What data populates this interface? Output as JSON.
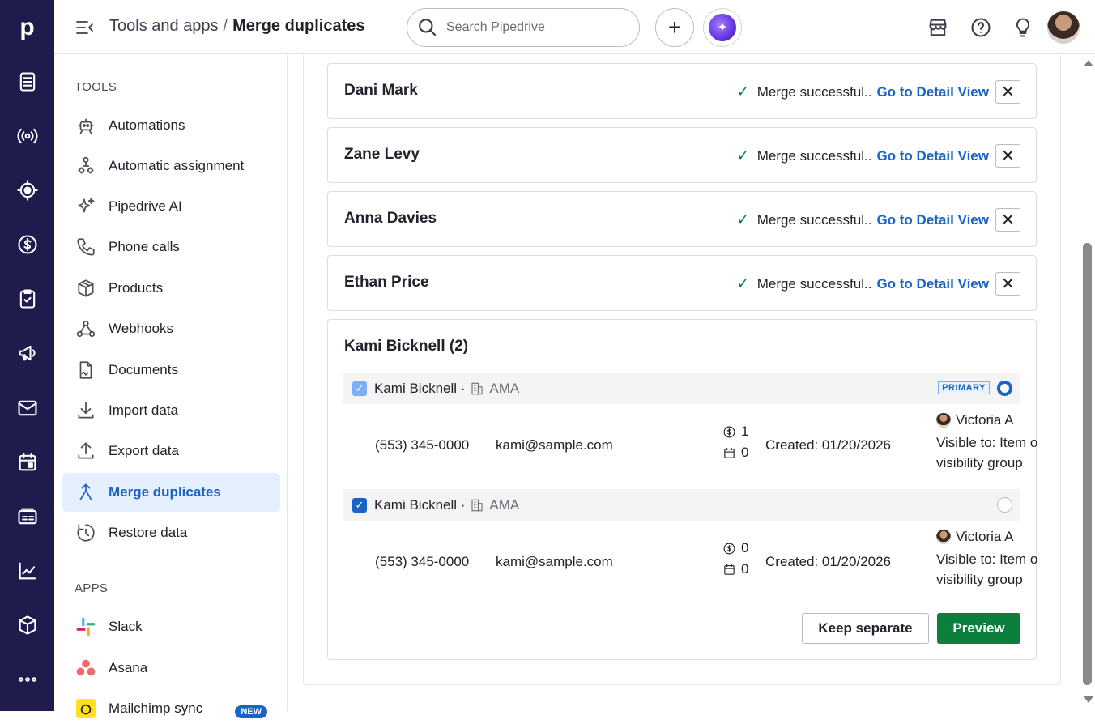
{
  "header": {
    "breadcrumb_parent": "Tools and apps",
    "breadcrumb_sep": "/",
    "breadcrumb_current": "Merge duplicates",
    "search_placeholder": "Search Pipedrive",
    "add_label": "+"
  },
  "rail": {
    "logo": "p",
    "icons": [
      "leads-icon",
      "campaigns-icon",
      "deals-icon",
      "money-icon",
      "tasks-icon",
      "megaphone-icon",
      "mail-icon",
      "calendar-icon",
      "contacts-icon",
      "insights-icon",
      "products-icon",
      "more-icon"
    ]
  },
  "sidebar": {
    "tools_title": "TOOLS",
    "tools": [
      {
        "label": "Automations",
        "icon": "robot-icon"
      },
      {
        "label": "Automatic assignment",
        "icon": "assignment-icon"
      },
      {
        "label": "Pipedrive AI",
        "icon": "sparkle-icon"
      },
      {
        "label": "Phone calls",
        "icon": "phone-icon"
      },
      {
        "label": "Products",
        "icon": "box-icon"
      },
      {
        "label": "Webhooks",
        "icon": "webhook-icon"
      },
      {
        "label": "Documents",
        "icon": "document-icon"
      },
      {
        "label": "Import data",
        "icon": "import-icon"
      },
      {
        "label": "Export data",
        "icon": "export-icon"
      },
      {
        "label": "Merge duplicates",
        "icon": "merge-icon"
      },
      {
        "label": "Restore data",
        "icon": "restore-icon"
      }
    ],
    "apps_title": "APPS",
    "apps": [
      {
        "label": "Slack",
        "icon": "slack-icon"
      },
      {
        "label": "Asana",
        "icon": "asana-icon"
      },
      {
        "label": "Mailchimp sync",
        "icon": "mailchimp-icon",
        "badge": "NEW"
      }
    ]
  },
  "merged": [
    {
      "name": "Dani Mark",
      "status": "Merge successful..",
      "link": "Go to Detail View"
    },
    {
      "name": "Zane Levy",
      "status": "Merge successful..",
      "link": "Go to Detail View"
    },
    {
      "name": "Anna Davies",
      "status": "Merge successful..",
      "link": "Go to Detail View"
    },
    {
      "name": "Ethan Price",
      "status": "Merge successful..",
      "link": "Go to Detail View"
    }
  ],
  "group": {
    "title": "Kami Bicknell (2)",
    "primary_label": "PRIMARY",
    "candidates": [
      {
        "name": "Kami Bicknell ·",
        "org": "AMA",
        "phone": "(553) 345-0000",
        "email": "kami@sample.com",
        "deals": "1",
        "activities": "0",
        "created": "Created: 01/20/2026",
        "owner": "Victoria A",
        "visibility_line1": "Visible to: Item owner's",
        "visibility_line2": "visibility group"
      },
      {
        "name": "Kami Bicknell ·",
        "org": "AMA",
        "phone": "(553) 345-0000",
        "email": "kami@sample.com",
        "deals": "0",
        "activities": "0",
        "created": "Created: 01/20/2026",
        "owner": "Victoria A",
        "visibility_line1": "Visible to: Item owner's",
        "visibility_line2": "visibility group"
      }
    ],
    "keep_label": "Keep separate",
    "preview_label": "Preview"
  },
  "colors": {
    "rail": "#1f1b4d",
    "accent": "#1b63c6",
    "success": "#0d7f3c"
  }
}
